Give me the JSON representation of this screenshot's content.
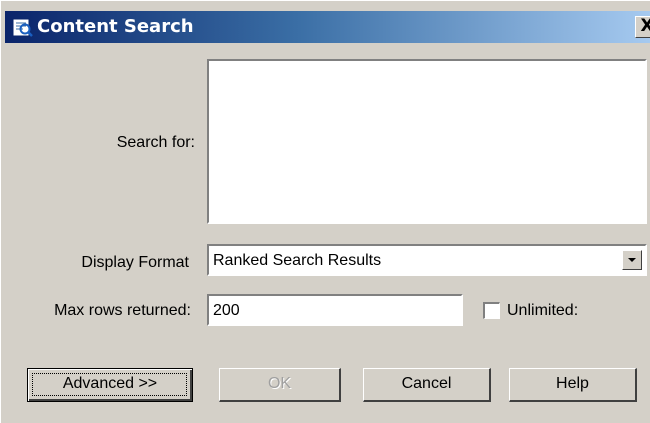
{
  "window": {
    "title": "Content Search",
    "close_label": "X",
    "icon": "search-app-icon"
  },
  "form": {
    "search_label": "Search for:",
    "search_value": "",
    "display_format_label": "Display Format",
    "display_format_value": "Ranked Search Results",
    "max_rows_label": "Max rows returned:",
    "max_rows_value": "200",
    "unlimited_label": "Unlimited:",
    "unlimited_checked": false
  },
  "buttons": {
    "advanced": "Advanced >>",
    "ok": "OK",
    "cancel": "Cancel",
    "help": "Help"
  },
  "colors": {
    "title_start": "#0a246a",
    "title_end": "#a6caf0",
    "face": "#d4d0c8"
  }
}
